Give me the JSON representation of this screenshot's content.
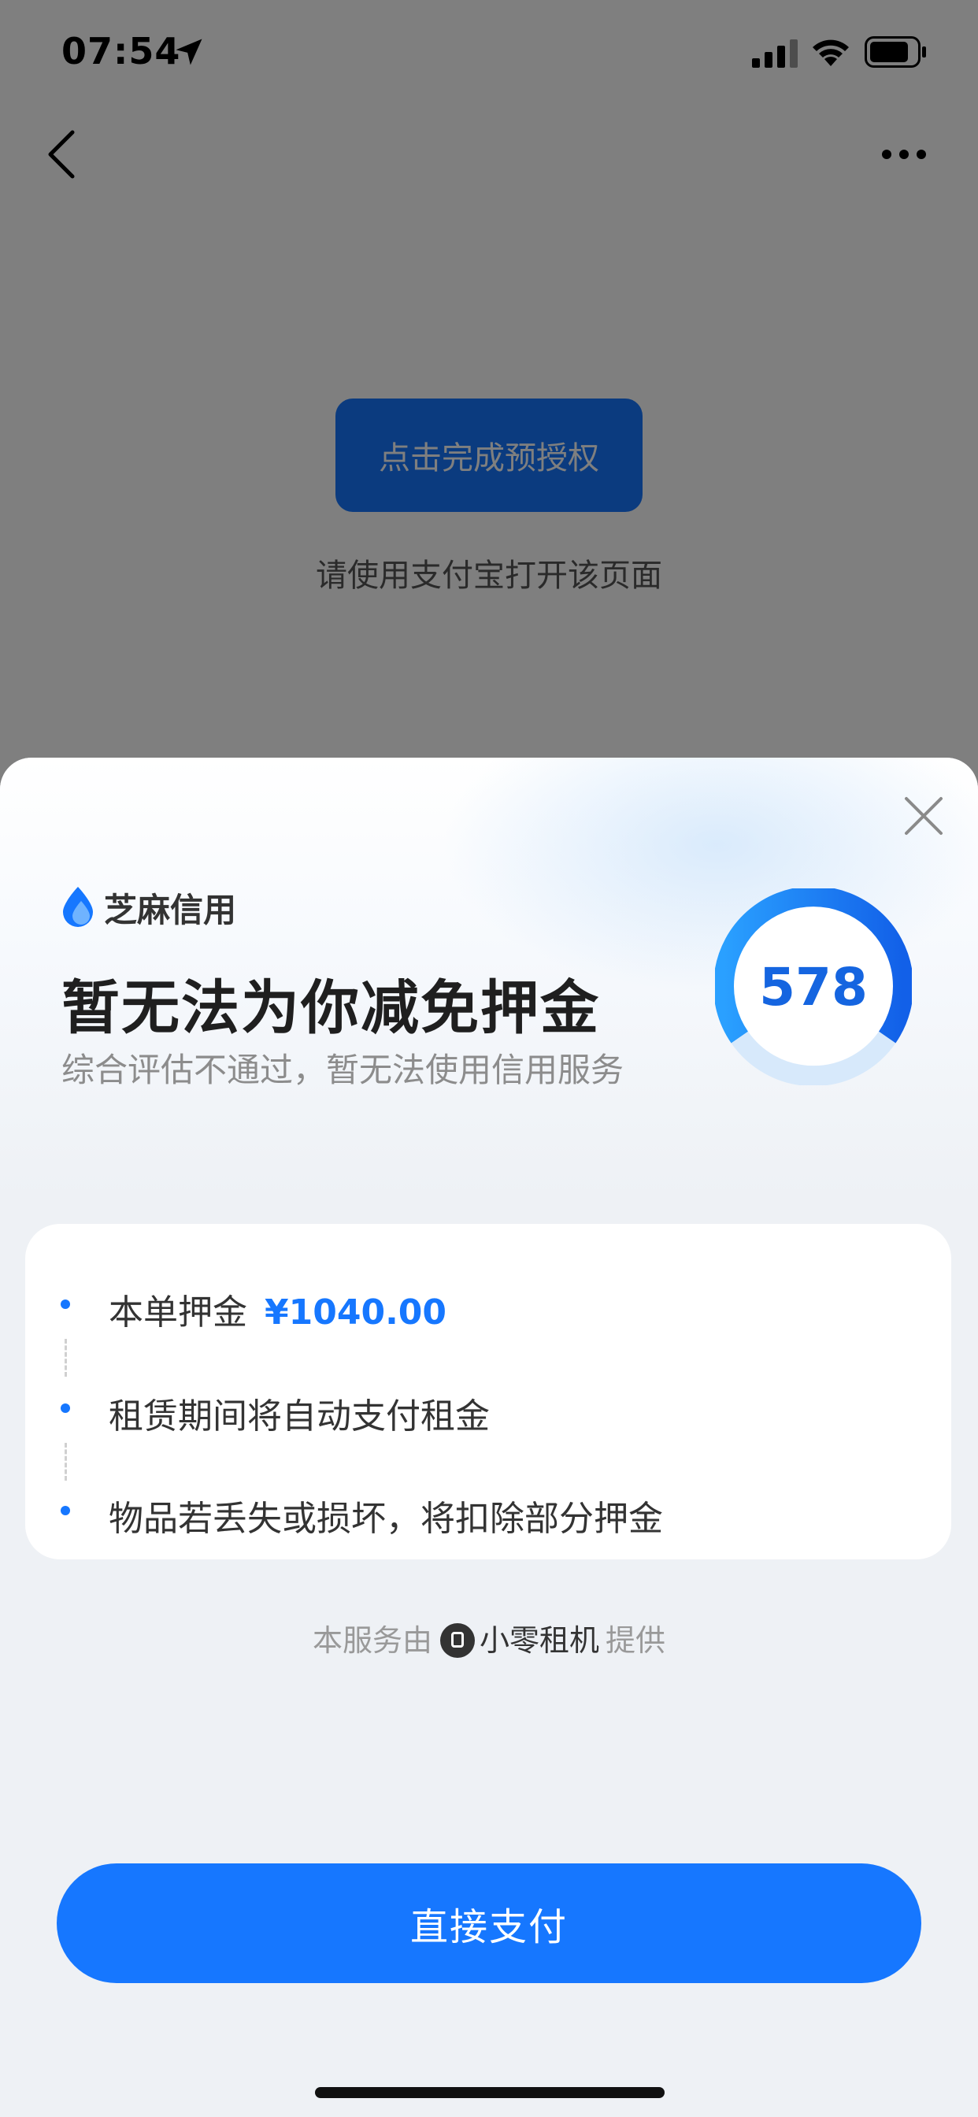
{
  "status_bar": {
    "time": "07:54"
  },
  "background_page": {
    "preauth_button": "点击完成预授权",
    "hint": "请使用支付宝打开该页面"
  },
  "sheet": {
    "brand": "芝麻信用",
    "title": "暂无法为你减免押金",
    "subtitle": "综合评估不通过，暂无法使用信用服务",
    "score": "578",
    "items": [
      {
        "label": "本单押金",
        "amount": "¥1040.00"
      },
      {
        "label": "租赁期间将自动支付租金"
      },
      {
        "label": "物品若丢失或损坏，将扣除部分押金"
      }
    ],
    "provider": {
      "prefix": "本服务由",
      "name": "小零租机",
      "suffix": "提供"
    },
    "pay_button": "直接支付"
  },
  "colors": {
    "accent": "#1677ff",
    "score_text": "#1565e0"
  }
}
